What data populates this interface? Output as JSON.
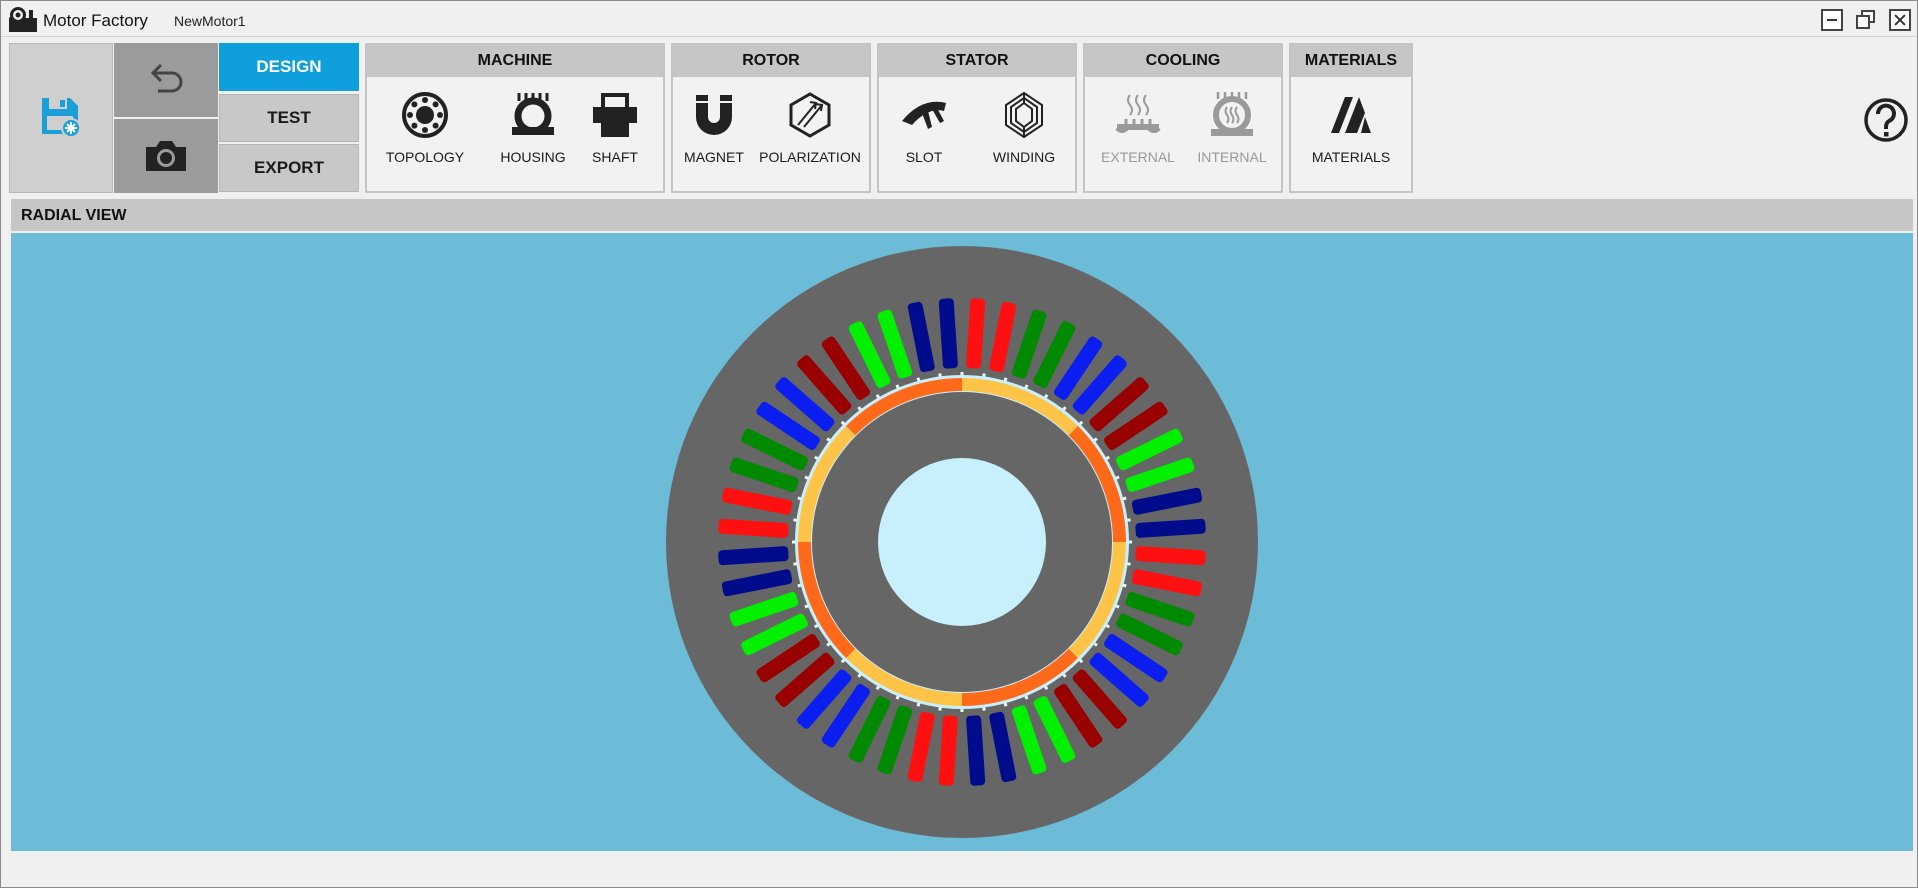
{
  "app": {
    "name": "Motor Factory",
    "document": "NewMotor1"
  },
  "window_controls": {
    "minimize": "minimize",
    "maximize": "restore",
    "close": "close"
  },
  "toolbar": {
    "save_icon": "save-floppy-icon",
    "undo_icon": "undo-arrow-icon",
    "snapshot_icon": "camera-icon",
    "modes": [
      {
        "label": "DESIGN",
        "active": true
      },
      {
        "label": "TEST",
        "active": false
      },
      {
        "label": "EXPORT",
        "active": false
      }
    ],
    "groups": [
      {
        "title": "MACHINE",
        "tools": [
          {
            "label": "TOPOLOGY",
            "icon": "topology-icon",
            "enabled": true
          },
          {
            "label": "HOUSING",
            "icon": "housing-icon",
            "enabled": true
          },
          {
            "label": "SHAFT",
            "icon": "shaft-icon",
            "enabled": true
          }
        ]
      },
      {
        "title": "ROTOR",
        "tools": [
          {
            "label": "MAGNET",
            "icon": "magnet-icon",
            "enabled": true
          },
          {
            "label": "POLARIZATION",
            "icon": "polarization-icon",
            "enabled": true
          }
        ]
      },
      {
        "title": "STATOR",
        "tools": [
          {
            "label": "SLOT",
            "icon": "slot-icon",
            "enabled": true
          },
          {
            "label": "WINDING",
            "icon": "winding-icon",
            "enabled": true
          }
        ]
      },
      {
        "title": "COOLING",
        "tools": [
          {
            "label": "EXTERNAL",
            "icon": "external-cooling-icon",
            "enabled": false
          },
          {
            "label": "INTERNAL",
            "icon": "internal-cooling-icon",
            "enabled": false
          }
        ]
      },
      {
        "title": "MATERIALS",
        "tools": [
          {
            "label": "MATERIALS",
            "icon": "materials-icon",
            "enabled": true
          }
        ]
      }
    ],
    "help_icon": "help-icon"
  },
  "radial_view": {
    "title": "RADIAL VIEW",
    "background": "#6cbbd7",
    "stator_color": "#666666",
    "shaft_color": "#c8f0fc",
    "slot_count": 48,
    "pole_count": 8,
    "magnet_colors": [
      "#ff6a1a",
      "#ffc447"
    ],
    "phase_colors": {
      "A": "#ff1010",
      "A_return": "#990000",
      "B": "#00f000",
      "B_return": "#008a00",
      "C": "#0a1ef0",
      "C_return": "#000c8c"
    },
    "winding_sequence": [
      "A",
      "A",
      "B_return",
      "B_return",
      "C",
      "C",
      "A_return",
      "A_return",
      "B",
      "B",
      "C_return",
      "C_return"
    ]
  }
}
